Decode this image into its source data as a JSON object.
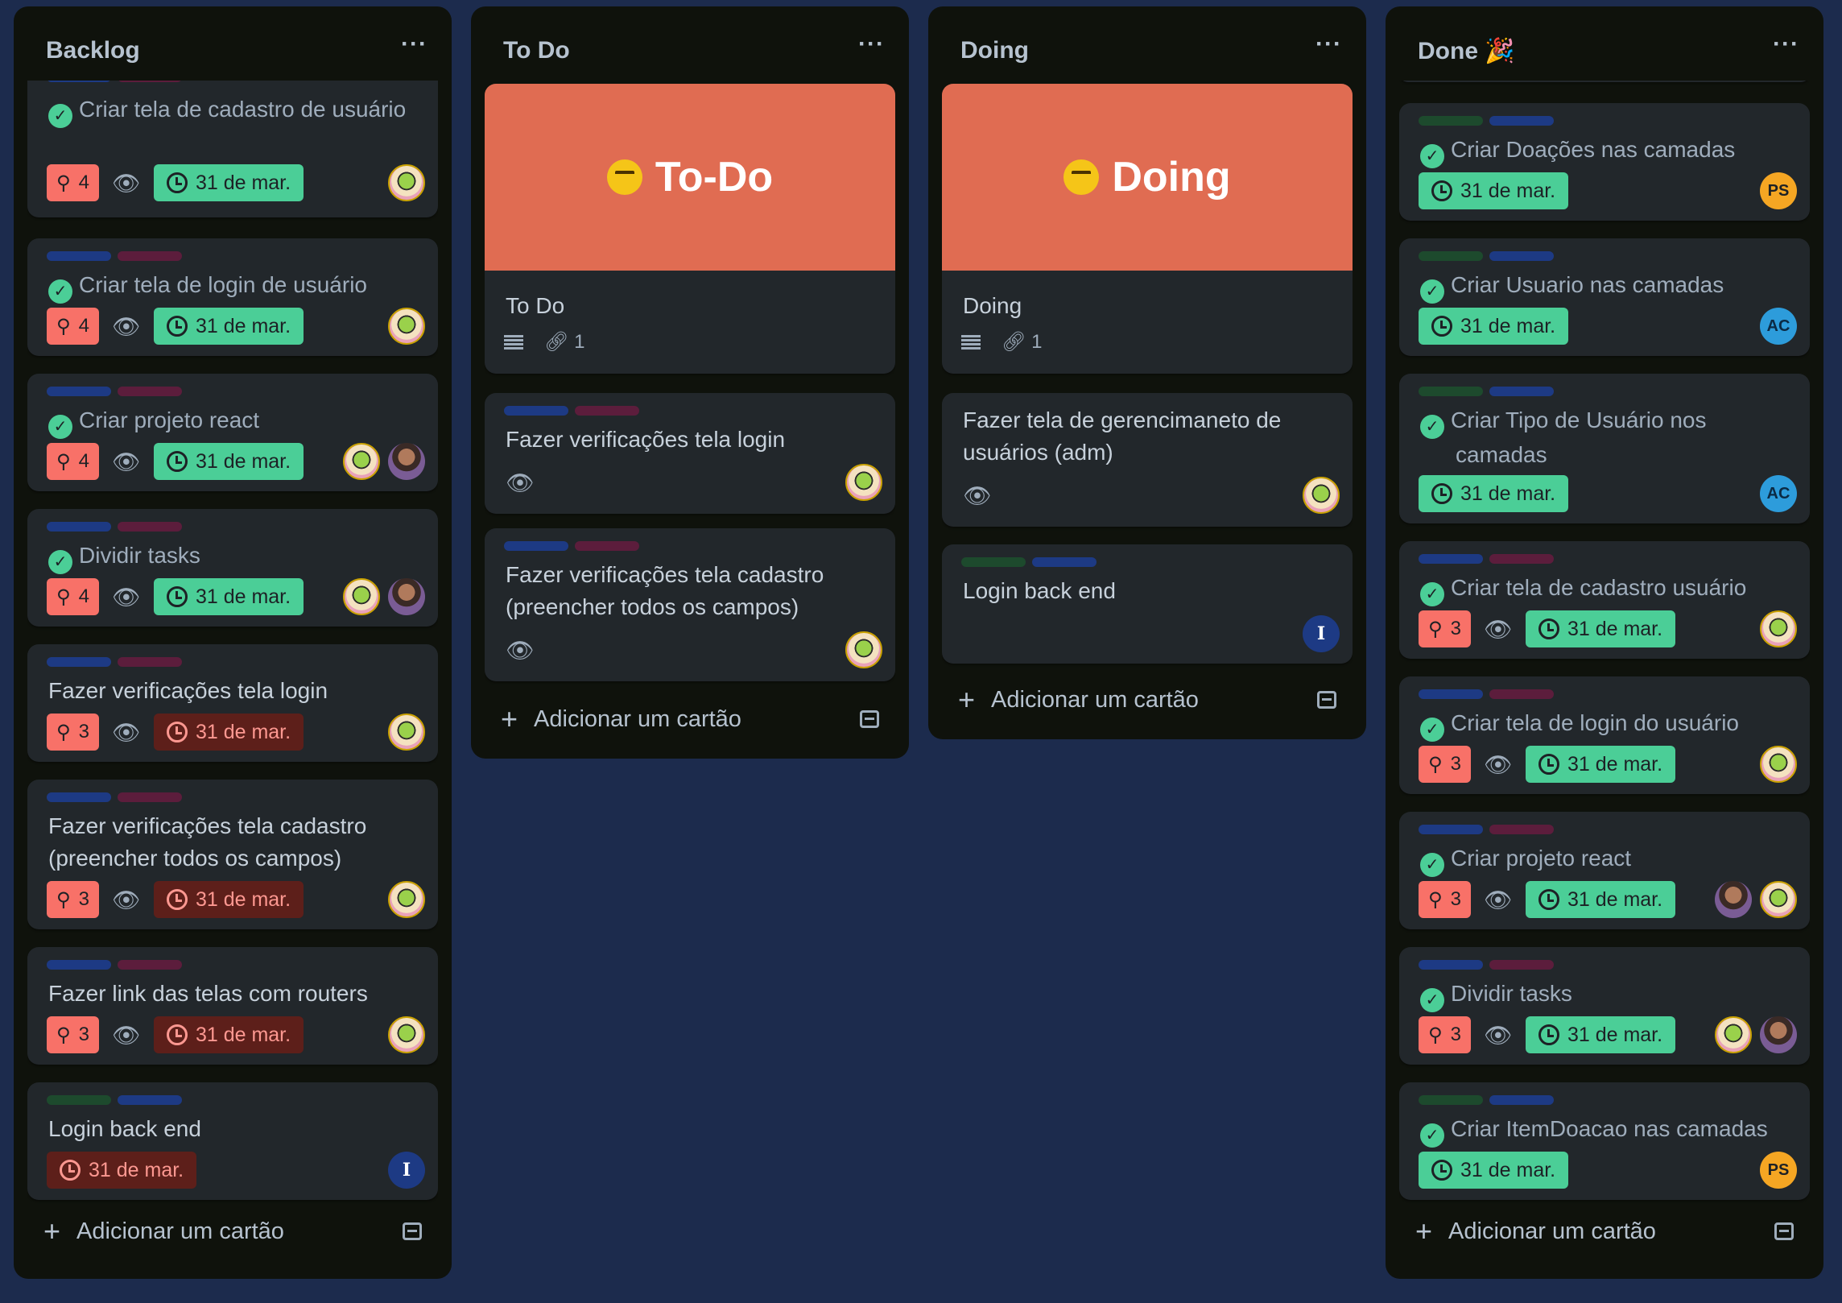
{
  "colors": {
    "board_bg": "#1c2b4d",
    "list_bg": "#0f120c",
    "card_bg": "#22272b",
    "due_complete": "#4bce97",
    "due_overdue": "#5d1f1a",
    "alert_badge": "#f87168",
    "cover": "#e06c52"
  },
  "common": {
    "add_card": "Adicionar um cartão",
    "date": "31 de mar.",
    "menu": "···"
  },
  "lists": [
    {
      "title": "Backlog",
      "cards": [
        {
          "title": "Criar tela de cadastro de usuário",
          "count": "4"
        },
        {
          "title": "Criar tela de login de usuário",
          "count": "4"
        },
        {
          "title": "Criar projeto react",
          "count": "4"
        },
        {
          "title": "Dividir tasks",
          "count": "4"
        },
        {
          "title": "Fazer verificações tela login",
          "count": "3"
        },
        {
          "title": "Fazer verificações tela cadastro (preencher todos os campos)",
          "count": "3"
        },
        {
          "title": "Fazer link das telas com routers",
          "count": "3"
        },
        {
          "title": "Login back end",
          "avatar": "I"
        }
      ]
    },
    {
      "title": "To Do",
      "cover": {
        "title": "To-Do",
        "emoji": "thinking-face-icon"
      },
      "cards": [
        {
          "title": "To Do",
          "attachments": "1"
        },
        {
          "title": "Fazer verificações tela login"
        },
        {
          "title": "Fazer verificações tela cadastro (preencher todos os campos)"
        }
      ]
    },
    {
      "title": "Doing",
      "cover": {
        "title": "Doing",
        "emoji": "nerd-face-icon"
      },
      "cards": [
        {
          "title": "Doing",
          "attachments": "1"
        },
        {
          "title": "Fazer tela de gerencimaneto de usuários (adm)"
        },
        {
          "title": "Login back end",
          "avatar": "I"
        }
      ]
    },
    {
      "title": "Done 🎉",
      "cards": [
        {
          "title": "Criar Doações nas camadas",
          "avatar": "PS"
        },
        {
          "title": "Criar Usuario nas camadas",
          "avatar": "AC"
        },
        {
          "title": "Criar Tipo de Usuário nos camadas",
          "avatar": "AC"
        },
        {
          "title": "Criar tela de cadastro usuário",
          "count": "3"
        },
        {
          "title": "Criar tela de login do usuário",
          "count": "3"
        },
        {
          "title": "Criar projeto react",
          "count": "3"
        },
        {
          "title": "Dividir tasks",
          "count": "3"
        },
        {
          "title": "Criar ItemDoacao nas camadas",
          "avatar": "PS"
        }
      ]
    }
  ]
}
